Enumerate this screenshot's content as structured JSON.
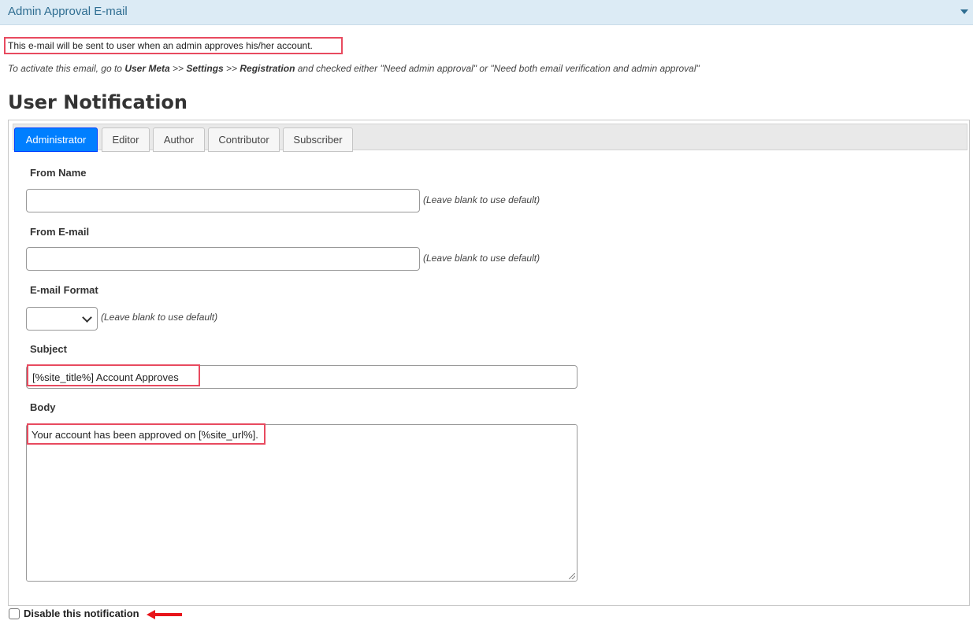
{
  "header": {
    "title": "Admin Approval E-mail",
    "toggle_icon": "caret-down-icon"
  },
  "intro_text": "This e-mail will be sent to user when an admin approves his/her account.",
  "hint": {
    "prefix": "To activate this email, go to ",
    "step1": "User Meta",
    "sep1": " >> ",
    "step2": "Settings",
    "sep2": " >> ",
    "step3": "Registration",
    "suffix": " and checked either \"Need admin approval\" or \"Need both email verification and admin approval\""
  },
  "section_title": "User Notification",
  "tabs": [
    {
      "label": "Administrator",
      "active": true
    },
    {
      "label": "Editor",
      "active": false
    },
    {
      "label": "Author",
      "active": false
    },
    {
      "label": "Contributor",
      "active": false
    },
    {
      "label": "Subscriber",
      "active": false
    }
  ],
  "form": {
    "from_name": {
      "label": "From Name",
      "value": "",
      "help": "(Leave blank to use default)"
    },
    "from_email": {
      "label": "From E-mail",
      "value": "",
      "help": "(Leave blank to use default)"
    },
    "email_format": {
      "label": "E-mail Format",
      "value": "",
      "help": "(Leave blank to use default)"
    },
    "subject": {
      "label": "Subject",
      "value": "[%site_title%] Account Approves"
    },
    "body": {
      "label": "Body",
      "value": "Your account has been approved on [%site_url%]."
    }
  },
  "disable_notification": {
    "label": "Disable this notification",
    "checked": false
  },
  "colors": {
    "header_bg": "#dcebf5",
    "header_text": "#2e6d91",
    "active_tab": "#007fff",
    "highlight_box": "#e84a5f",
    "arrow": "#e8141a"
  }
}
